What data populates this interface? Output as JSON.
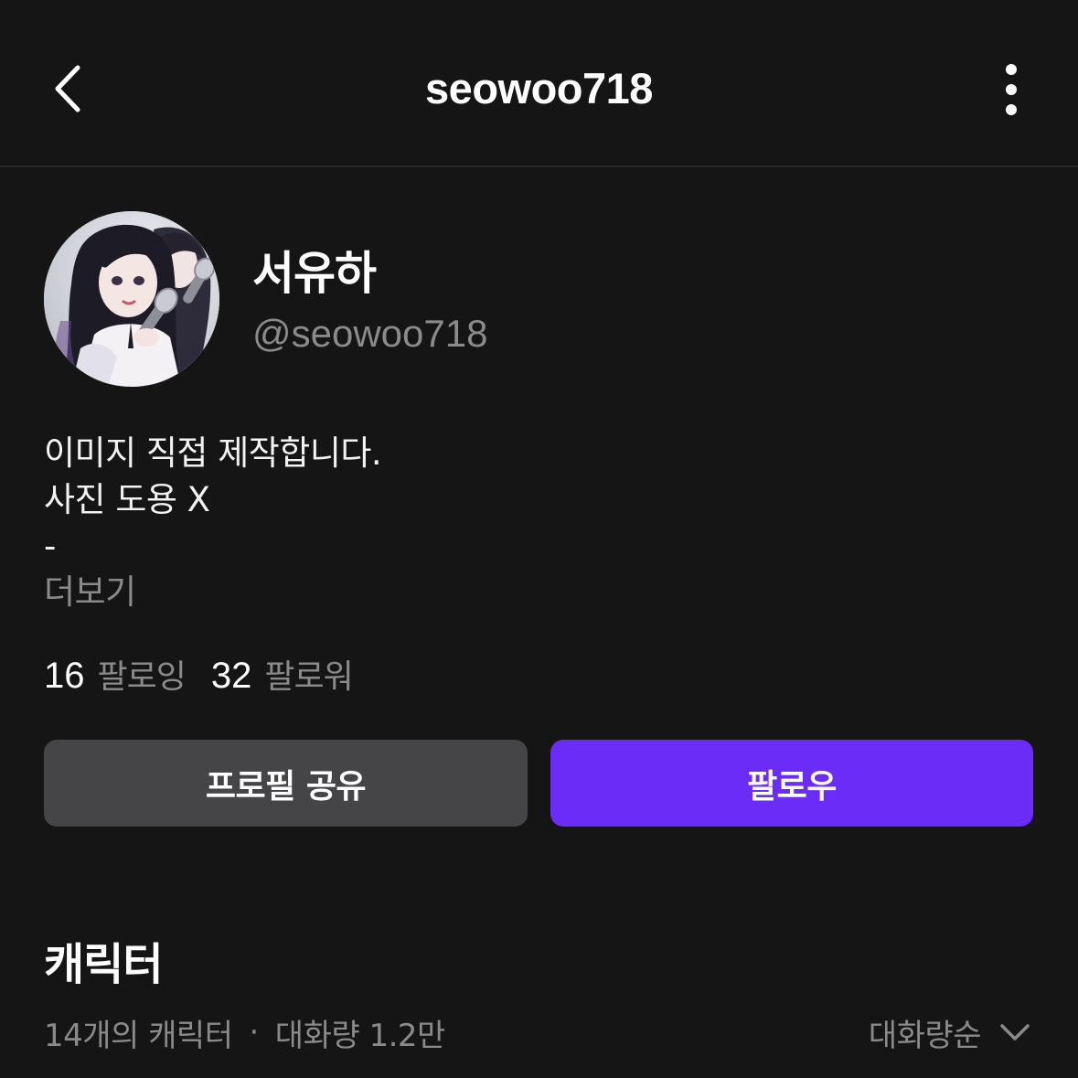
{
  "header": {
    "title": "seowoo718",
    "back_icon": "chevron-left-icon",
    "more_icon": "more-vertical-icon"
  },
  "profile": {
    "display_name": "서유하",
    "handle": "@seowoo718",
    "bio_lines": [
      "이미지 직접 제작합니다.",
      "사진 도용 X",
      "-"
    ],
    "more_label": "더보기",
    "following_count": "16",
    "following_label": "팔로잉",
    "followers_count": "32",
    "followers_label": "팔로워"
  },
  "actions": {
    "share_label": "프로필 공유",
    "follow_label": "팔로우"
  },
  "characters": {
    "title": "캐릭터",
    "count_text": "14개의 캐릭터",
    "separator": "·",
    "conversations_text": "대화량 1.2만",
    "sort_label": "대화량순",
    "sort_icon": "chevron-down-icon"
  },
  "colors": {
    "background": "#151515",
    "follow_button": "#6c2cf8",
    "share_button": "#454547",
    "muted_text": "#8a8a8a"
  }
}
